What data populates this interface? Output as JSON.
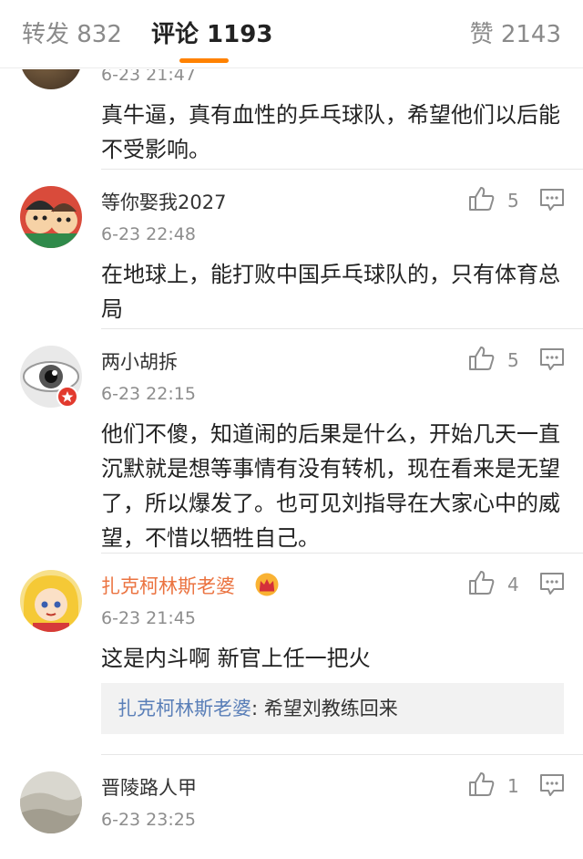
{
  "tabs": {
    "repost": "转发 832",
    "comments": "评论 1193",
    "likes": "赞 2143"
  },
  "colors": {
    "accent": "#ff8200",
    "vip_name": "#eb7340",
    "reply_author": "#5a7fb8"
  },
  "comments": [
    {
      "name": "",
      "time": "6-23 21:47",
      "text": "真牛逼，真有血性的乒乓球队，希望他们以后能不受影响。"
    },
    {
      "name": "等你娶我2027",
      "time": "6-23 22:48",
      "text": "在地球上，能打败中国乒乓球队的，只有体育总局",
      "likes": "5"
    },
    {
      "name": "两小胡拆",
      "time": "6-23 22:15",
      "text": "他们不傻，知道闹的后果是什么，开始几天一直沉默就是想等事情有没有转机，现在看来是无望了，所以爆发了。也可见刘指导在大家心中的威望，不惜以牺牲自己。",
      "likes": "5"
    },
    {
      "name": "扎克柯林斯老婆",
      "time": "6-23 21:45",
      "text": "这是内斗啊 新官上任一把火",
      "likes": "4",
      "reply": {
        "author": "扎克柯林斯老婆",
        "sep": ": ",
        "text": "希望刘教练回来"
      }
    },
    {
      "name": "晋陵路人甲",
      "time": "6-23 23:25",
      "text": "",
      "likes": "1"
    }
  ]
}
